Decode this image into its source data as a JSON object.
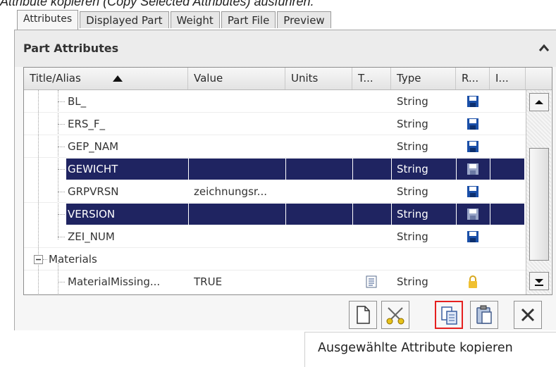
{
  "caption": "Attribute kopieren (Copy Selected Attributes) ausführen.",
  "tabs": [
    "Attributes",
    "Displayed Part",
    "Weight",
    "Part File",
    "Preview"
  ],
  "panel": {
    "title": "Part Attributes"
  },
  "grid": {
    "columns": [
      "Title/Alias",
      "Value",
      "Units",
      "T...",
      "Type",
      "R...",
      "I..."
    ],
    "rows": [
      {
        "title": "BL_",
        "value": "",
        "units": "",
        "type": "String",
        "r_icon": "save-icon",
        "selected": false
      },
      {
        "title": "ERS_F_",
        "value": "",
        "units": "",
        "type": "String",
        "r_icon": "save-icon",
        "selected": false
      },
      {
        "title": "GEP_NAM",
        "value": "",
        "units": "",
        "type": "String",
        "r_icon": "save-icon",
        "selected": false
      },
      {
        "title": "GEWICHT",
        "value": "",
        "units": "",
        "type": "String",
        "r_icon": "save-icon",
        "selected": true
      },
      {
        "title": "GRPVRSN",
        "value": "zeichnungsr...",
        "units": "",
        "type": "String",
        "r_icon": "save-icon",
        "selected": false
      },
      {
        "title": "VERSION",
        "value": "",
        "units": "",
        "type": "String",
        "r_icon": "save-icon",
        "selected": true
      },
      {
        "title": "ZEI_NUM",
        "value": "",
        "units": "",
        "type": "String",
        "r_icon": "save-icon",
        "selected": false
      },
      {
        "group": "Materials"
      },
      {
        "title": "MaterialMissing...",
        "value": "TRUE",
        "units": "",
        "type": "String",
        "t_icon": "document-icon",
        "r_icon": "lock-icon",
        "selected": false
      }
    ]
  },
  "toolbar": [
    "new-icon",
    "cut-icon",
    "copy-icon",
    "paste-icon",
    "delete-icon"
  ],
  "tooltip": "Ausgewählte Attribute kopieren",
  "colors": {
    "selection": "#1f2461",
    "highlight_border": "#e5201f"
  }
}
